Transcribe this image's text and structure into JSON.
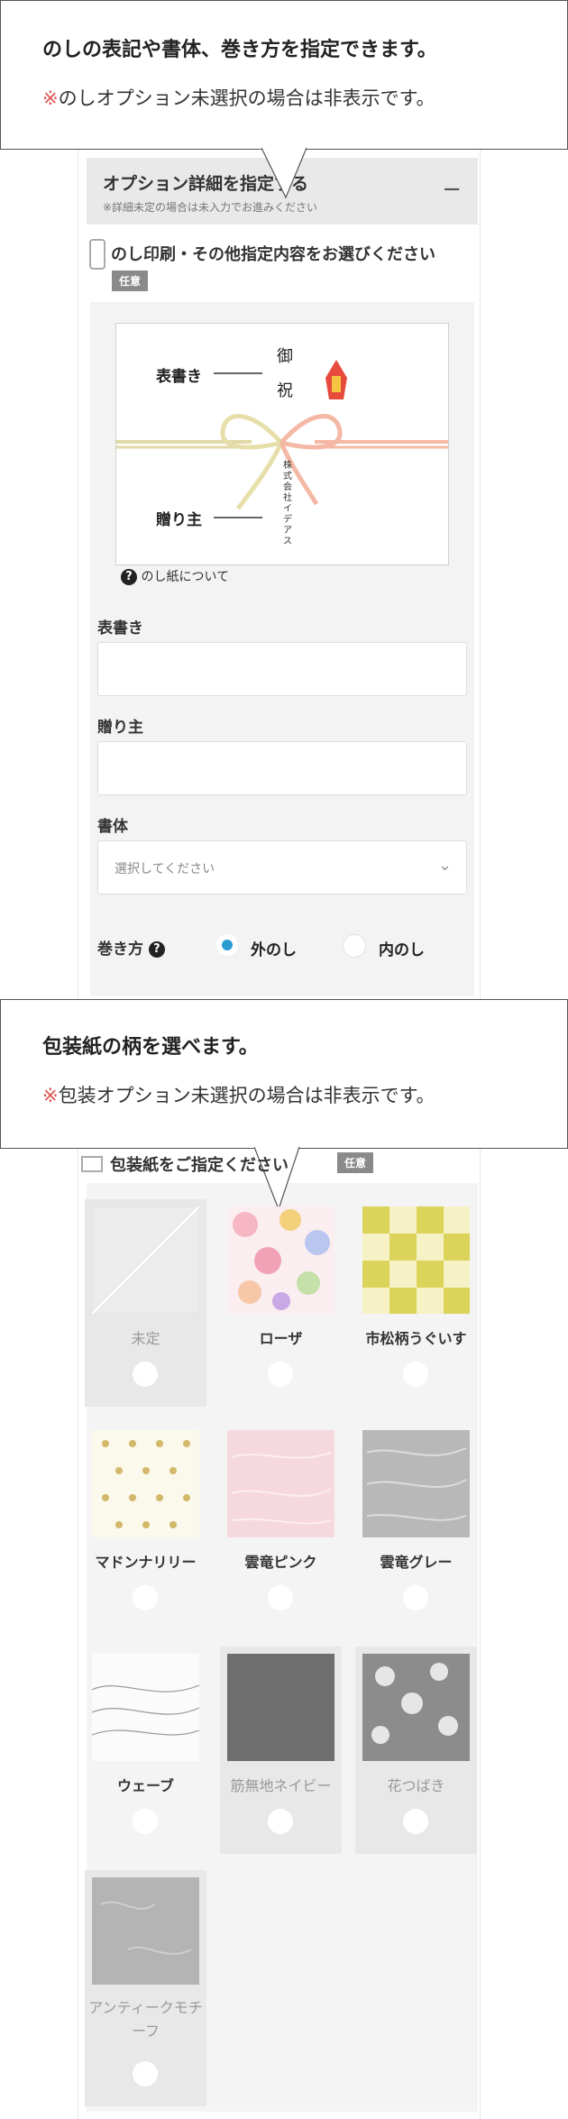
{
  "options_bar": {
    "title": "オプション詳細を指定する",
    "subtitle": "※詳細未定の場合は未入力でお進みください",
    "toggle": "−"
  },
  "callout1": {
    "title": "のしの表記や書体、巻き方を指定できます。",
    "note_mark": "※",
    "note": "のしオプション未選択の場合は非表示です。"
  },
  "noshi": {
    "section_title": "のし印刷・その他指定内容をお選びください",
    "badge": "任意",
    "sample": {
      "top_char1": "御",
      "top_char2": "祝",
      "label_omote": "表書き",
      "label_okuri": "贈り主",
      "vertical_company": "株式会社イデアス"
    },
    "about_link": "のし紙について",
    "omote_label": "表書き",
    "omote_value": "",
    "okuri_label": "贈り主",
    "okuri_value": "",
    "font_label": "書体",
    "font_placeholder": "選択してください",
    "wrap_label": "巻き方",
    "wrap_options": [
      "外のし",
      "内のし"
    ],
    "wrap_selected": "外のし"
  },
  "callout2": {
    "title": "包装紙の柄を選べます。",
    "note_mark": "※",
    "note": "包装オプション未選択の場合は非表示です。"
  },
  "wrapping": {
    "section_title": "包装紙をご指定ください",
    "badge": "任意",
    "items": [
      {
        "name": "未定"
      },
      {
        "name": "ローザ"
      },
      {
        "name": "市松柄うぐいす"
      },
      {
        "name": "マドンナリリー"
      },
      {
        "name": "雲竜ピンク"
      },
      {
        "name": "雲竜グレー"
      },
      {
        "name": "ウェーブ"
      },
      {
        "name": "筋無地ネイビー"
      },
      {
        "name": "花つばき"
      },
      {
        "name": "アンティークモチーフ"
      }
    ]
  },
  "colors": {
    "accent_radio": "#2c9bd1",
    "note_red": "#e05252",
    "badge_gray": "#8a8a8a"
  }
}
